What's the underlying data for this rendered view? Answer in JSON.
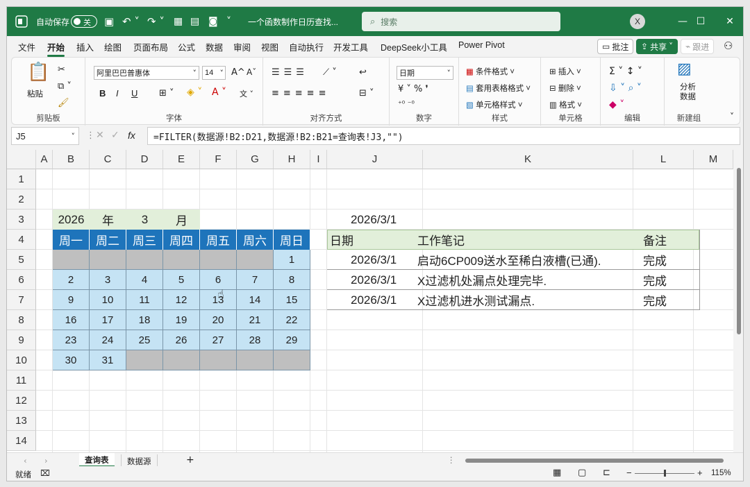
{
  "title": {
    "autosave": "自动保存",
    "toggle": "关",
    "filename": "一个函数制作日历查找...",
    "search_placeholder": "搜索",
    "user": "X"
  },
  "menu": [
    "文件",
    "开始",
    "插入",
    "绘图",
    "页面布局",
    "公式",
    "数据",
    "审阅",
    "视图",
    "自动执行",
    "开发工具",
    "DeepSeek小工具",
    "Power Pivot"
  ],
  "menu_active": "开始",
  "top_actions": {
    "comment": "批注",
    "share": "共享",
    "catchup": "跟进"
  },
  "ribbon": {
    "clipboard": {
      "paste": "粘贴",
      "label": "剪贴板"
    },
    "font": {
      "name": "阿里巴巴普惠体",
      "size": "14",
      "label": "字体",
      "bold": "B",
      "italic": "I",
      "underline": "U"
    },
    "align": {
      "label": "对齐方式"
    },
    "number": {
      "format": "日期",
      "label": "数字"
    },
    "styles": {
      "cond": "条件格式",
      "table": "套用表格格式",
      "cell": "单元格样式",
      "label": "样式"
    },
    "cells": {
      "insert": "插入",
      "delete": "删除",
      "format": "格式",
      "label": "单元格"
    },
    "edit": {
      "label": "编辑"
    },
    "analysis": {
      "btn1": "分析",
      "btn2": "数据",
      "label": "新建组"
    }
  },
  "formula_bar": {
    "namebox": "J5",
    "fx": "fx",
    "formula": "=FILTER(数据源!B2:D21,数据源!B2:B21=查询表!J3,\"\")"
  },
  "columns": [
    "A",
    "B",
    "C",
    "D",
    "E",
    "F",
    "G",
    "H",
    "I",
    "J",
    "K",
    "L",
    "M"
  ],
  "rows": [
    "1",
    "2",
    "3",
    "4",
    "5",
    "6",
    "7",
    "8",
    "9",
    "10",
    "11",
    "12",
    "13",
    "14"
  ],
  "calendar": {
    "year": "2026",
    "year_label": "年",
    "month": "3",
    "month_label": "月",
    "weekdays": [
      "周一",
      "周二",
      "周三",
      "周四",
      "周五",
      "周六",
      "周日"
    ],
    "weeks": [
      [
        "",
        "",
        "",
        "",
        "",
        "",
        "1"
      ],
      [
        "2",
        "3",
        "4",
        "5",
        "6",
        "7",
        "8"
      ],
      [
        "9",
        "10",
        "11",
        "12",
        "13",
        "14",
        "15"
      ],
      [
        "16",
        "17",
        "18",
        "19",
        "20",
        "21",
        "22"
      ],
      [
        "23",
        "24",
        "25",
        "26",
        "27",
        "28",
        "29"
      ],
      [
        "30",
        "31",
        "",
        "",
        "",
        "",
        ""
      ]
    ]
  },
  "query": {
    "date": "2026/3/1",
    "headers": [
      "日期",
      "工作笔记",
      "备注"
    ],
    "rows": [
      [
        "2026/3/1",
        "启动6CP009送水至稀白液槽(已通).",
        "完成"
      ],
      [
        "2026/3/1",
        "X过滤机处漏点处理完毕.",
        "完成"
      ],
      [
        "2026/3/1",
        "X过滤机进水测试漏点.",
        "完成"
      ]
    ]
  },
  "sheets": [
    "查询表",
    "数据源"
  ],
  "active_sheet": "查询表",
  "status": {
    "ready": "就绪",
    "zoom": "115%"
  },
  "colors": {
    "brand": "#1f7a45",
    "weekday_header": "#1e74bb",
    "day_cell": "#c5e3f4",
    "empty_cell": "#bfbfbf",
    "green_header": "#e2efda"
  }
}
